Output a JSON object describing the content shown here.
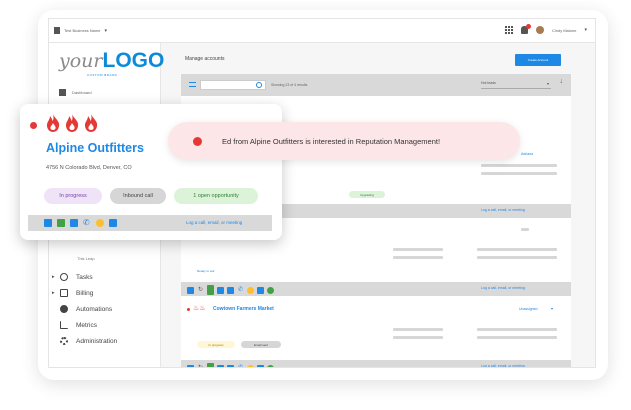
{
  "topbar": {
    "business_name": "Test Business Name",
    "user_name": "Cindy Malone"
  },
  "sidebar": {
    "logo_your": "your",
    "logo_logo": "LOGO",
    "logo_sub": "CUSTOM BRAND",
    "dashboard_label": "Dashboard",
    "sub_label": "This Leap",
    "items": [
      {
        "label": "Tasks",
        "icon": "check-circle-icon",
        "chevron": true
      },
      {
        "label": "Billing",
        "icon": "billing-icon",
        "chevron": true
      },
      {
        "label": "Automations",
        "icon": "automation-icon",
        "chevron": false
      },
      {
        "label": "Metrics",
        "icon": "bar-chart-icon",
        "chevron": false
      },
      {
        "label": "Administration",
        "icon": "gear-icon",
        "chevron": false
      }
    ]
  },
  "main": {
    "title": "Manage accounts",
    "primary_button": "Create Account",
    "search_placeholder": "",
    "showing_text": "Showing 23 of 4 results",
    "sort_label": "Hot leads",
    "row1_assigned": "Adriana",
    "row1_status": "Upgrading",
    "row2_status": "Ready to sell",
    "row3_name": "Cowtown Farmers Market",
    "row3_assigned": "Unassigned",
    "row3_pill_a": "In progress",
    "row3_pill_b": "Email sent",
    "log_link": "Log a call, email, or meeting"
  },
  "card": {
    "name": "Alpine Outfitters",
    "address": "4756 N Colorado Blvd, Denver, CO",
    "pills": [
      {
        "label": "In progress",
        "bg": "#efe3f7",
        "color": "#7b3fa8",
        "width": 58
      },
      {
        "label": "Inbound call",
        "bg": "#d6d6d6",
        "color": "#444",
        "width": 56
      },
      {
        "label": "1 open opportunity",
        "bg": "#dcf3d9",
        "color": "#2e7d32",
        "width": 84
      }
    ],
    "log_link": "Log a call, email, or meeting"
  },
  "notification": {
    "text": "Ed from Alpine Outfitters is interested in Reputation Management!"
  },
  "colors": {
    "accent": "#1e88e5",
    "hot": "#e53935"
  }
}
